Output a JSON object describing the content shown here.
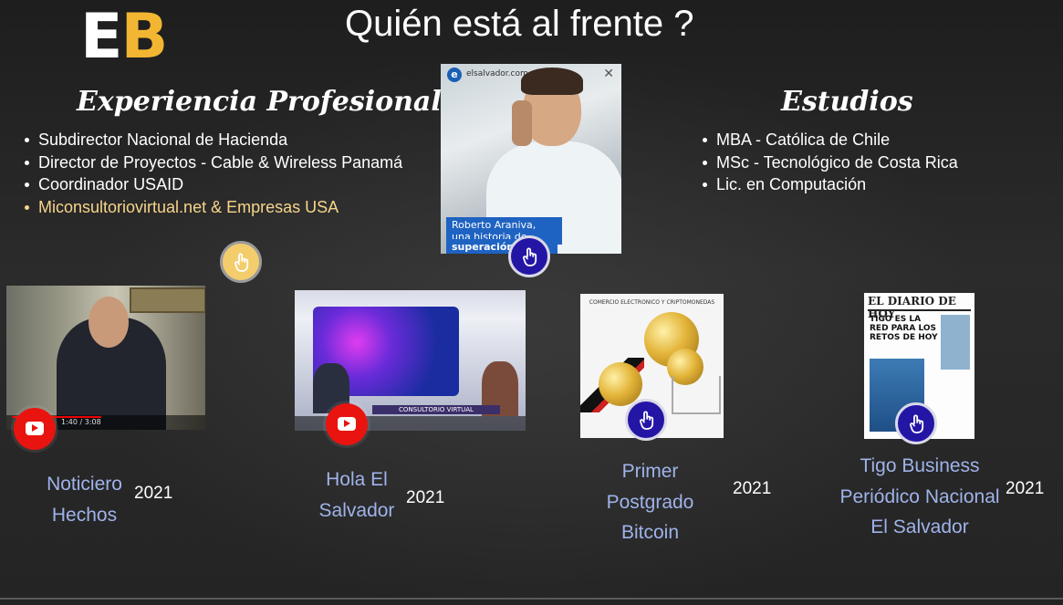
{
  "slide": {
    "logo": {
      "letter1": "E",
      "letter2": "B"
    },
    "title": "Quién está al frente ?",
    "experience": {
      "heading": "Experiencia Profesional",
      "items": [
        "Subdirector Nacional de Hacienda",
        "Director de Proyectos - Cable & Wireless Panamá",
        "Coordinador USAID",
        "Miconsultoriovirtual.net & Empresas USA"
      ]
    },
    "studies": {
      "heading": "Estudios",
      "items": [
        "MBA - Católica de Chile",
        "MSc - Tecnológico de Costa Rica",
        "Lic. en Computación"
      ]
    },
    "profile_card": {
      "site": "elsalvador.com",
      "close_icon": "close-icon",
      "caption_line1": "Roberto Araniva, una historia de",
      "caption_line2": "superación y ... ación digital"
    },
    "media": [
      {
        "caption": "Noticiero Hechos",
        "caption_lines": [
          "Noticiero",
          "Hechos"
        ],
        "year": "2021",
        "icon": "youtube-icon"
      },
      {
        "caption": "Hola El Salvador",
        "caption_lines": [
          "Hola El",
          "Salvador"
        ],
        "year": "2021",
        "icon": "youtube-icon",
        "banner": "CONSULTORIO VIRTUAL"
      },
      {
        "caption": "Primer Postgrado Bitcoin",
        "caption_lines": [
          "Primer",
          "Postgrado",
          "Bitcoin"
        ],
        "year": "2021",
        "icon": "tap-icon",
        "header": "COMERCIO ELECTRONICO Y CRIPTOMONEDAS"
      },
      {
        "caption": "Tigo Business Periódico Nacional El Salvador",
        "caption_lines": [
          "Tigo Business",
          "Periódico Nacional",
          "El Salvador"
        ],
        "year": "2021",
        "icon": "tap-icon",
        "masthead": "EL DIARIO DE HOY",
        "headline": "TIGO ES LA RED PARA LOS RETOS DE HOY"
      }
    ],
    "video_time": "1:40 / 3:08",
    "colors": {
      "background": "#262626",
      "logo_accent": "#f2b632",
      "caption": "#9fb3ea",
      "gold_item": "#f6d58a",
      "tap_button": "#2416a5",
      "youtube": "#e9140f"
    }
  }
}
